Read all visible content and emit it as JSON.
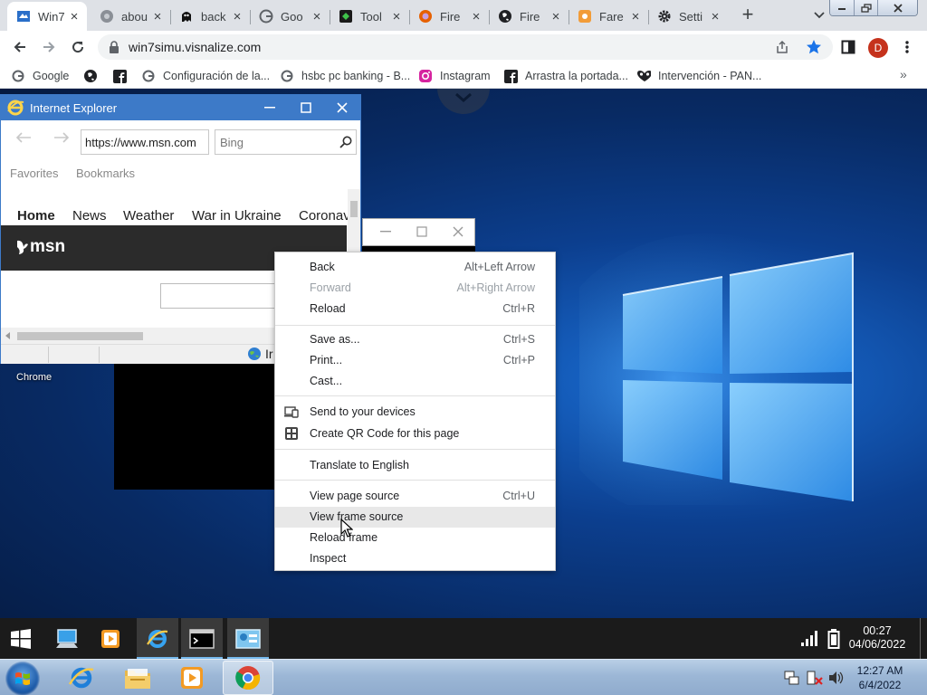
{
  "colors": {
    "tab_strip": "#dee1e6",
    "ie_title": "#3d7ac8",
    "desktop_deep": "#082a63",
    "logo_light": "#4aa8f0",
    "menu_highlight": "#e8e8e8",
    "avatar": "#c5321c"
  },
  "browser": {
    "tabs": [
      {
        "title": "Win7",
        "icon": "win7simu-icon",
        "active": true
      },
      {
        "title": "abou",
        "icon": "globe-gray-icon"
      },
      {
        "title": "back",
        "icon": "ghost-icon"
      },
      {
        "title": "Goo",
        "icon": "google-icon"
      },
      {
        "title": "Tool",
        "icon": "tool-icon"
      },
      {
        "title": "Fire",
        "icon": "firefox-icon"
      },
      {
        "title": "Fire",
        "icon": "globe-icon"
      },
      {
        "title": "Fare",
        "icon": "fare-icon"
      },
      {
        "title": "Setti",
        "icon": "gear-icon"
      }
    ],
    "new_tab": "+",
    "url": "win7simu.visnalize.com",
    "avatar_letter": "D",
    "bookmarks": [
      {
        "label": "Google",
        "icon": "google-icon"
      },
      {
        "label": "",
        "icon": "globe-icon"
      },
      {
        "label": "",
        "icon": "facebook-icon"
      },
      {
        "label": "Configuración de la...",
        "icon": "google-icon"
      },
      {
        "label": "hsbc pc banking - B...",
        "icon": "google-icon"
      },
      {
        "label": "Instagram",
        "icon": "instagram-icon"
      },
      {
        "label": "Arrastra la portada...",
        "icon": "facebook-icon"
      },
      {
        "label": "Intervención - PAN...",
        "icon": "pan-icon"
      }
    ],
    "bookmarks_more": "»"
  },
  "ie": {
    "title": "Internet Explorer",
    "address": "https://www.msn.com",
    "search_placeholder": "Bing",
    "favorites": "Favorites",
    "bookmarks": "Bookmarks",
    "nav": [
      "Home",
      "News",
      "Weather",
      "War in Ukraine",
      "Coronav"
    ],
    "msn_logo": "msn",
    "status_zone": "Ir"
  },
  "desktop": {
    "icon_label": "Chrome"
  },
  "context_menu": {
    "items": [
      {
        "label": "Back",
        "shortcut": "Alt+Left Arrow"
      },
      {
        "label": "Forward",
        "shortcut": "Alt+Right Arrow",
        "disabled": true
      },
      {
        "label": "Reload",
        "shortcut": "Ctrl+R"
      },
      {
        "label": "Save as...",
        "shortcut": "Ctrl+S"
      },
      {
        "label": "Print...",
        "shortcut": "Ctrl+P"
      },
      {
        "label": "Cast...",
        "shortcut": ""
      },
      {
        "label": "Send to your devices",
        "shortcut": "",
        "icon": "devices-icon"
      },
      {
        "label": "Create QR Code for this page",
        "shortcut": "",
        "icon": "qr-code-icon"
      },
      {
        "label": "Translate to English",
        "shortcut": ""
      },
      {
        "label": "View page source",
        "shortcut": "Ctrl+U"
      },
      {
        "label": "View frame source",
        "shortcut": "",
        "highlighted": true
      },
      {
        "label": "Reload frame",
        "shortcut": ""
      },
      {
        "label": "Inspect",
        "shortcut": ""
      }
    ]
  },
  "taskbar_win10": {
    "time": "00:27",
    "date": "04/06/2022"
  },
  "taskbar_win7": {
    "time": "12:27 AM",
    "date": "6/4/2022"
  }
}
